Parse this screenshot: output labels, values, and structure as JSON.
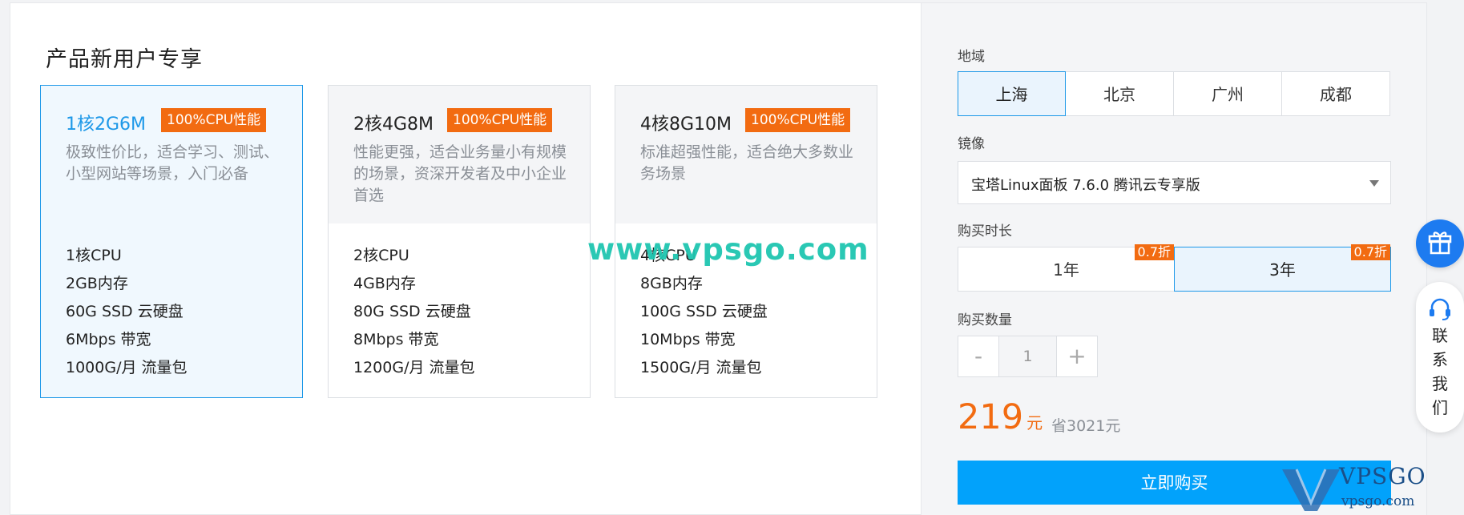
{
  "main": {
    "title": "产品新用户专享",
    "watermark": "www.vpsgo.com",
    "plans": [
      {
        "name": "1核2G6M",
        "badge": "100%CPU性能",
        "desc": "极致性价比，适合学习、测试、小型网站等场景，入门必备",
        "selected": true,
        "specs": [
          "1核CPU",
          "2GB内存",
          "60G SSD 云硬盘",
          "6Mbps 带宽",
          "1000G/月 流量包"
        ]
      },
      {
        "name": "2核4G8M",
        "badge": "100%CPU性能",
        "desc": "性能更强，适合业务量小有规模的场景，资深开发者及中小企业首选",
        "selected": false,
        "specs": [
          "2核CPU",
          "4GB内存",
          "80G SSD 云硬盘",
          "8Mbps 带宽",
          "1200G/月 流量包"
        ]
      },
      {
        "name": "4核8G10M",
        "badge": "100%CPU性能",
        "desc": "标准超强性能，适合绝大多数业务场景",
        "selected": false,
        "specs": [
          "4核CPU",
          "8GB内存",
          "100G SSD 云硬盘",
          "10Mbps 带宽",
          "1500G/月 流量包"
        ]
      }
    ]
  },
  "sidebar": {
    "region_label": "地域",
    "regions": [
      "上海",
      "北京",
      "广州",
      "成都"
    ],
    "region_selected": "上海",
    "image_label": "镜像",
    "image_value": "宝塔Linux面板 7.6.0 腾讯云专享版",
    "duration_label": "购买时长",
    "durations": [
      {
        "label": "1年",
        "discount": "0.7折",
        "active": false
      },
      {
        "label": "3年",
        "discount": "0.7折",
        "active": true
      }
    ],
    "quantity_label": "购买数量",
    "quantity": {
      "minus": "-",
      "value": "1",
      "plus": "+"
    },
    "price": "219",
    "price_unit": "元",
    "savings": "省3021元",
    "buy_label": "立即购买"
  },
  "float": {
    "contact": "联系我们"
  },
  "logo": {
    "top": "VPSGO",
    "bottom": "vpsgo.com"
  },
  "colors": {
    "accent": "#1d98e8",
    "buy_button": "#02a2fb",
    "badge": "#f26b11",
    "price": "#f26b11"
  },
  "icons": [
    "gift-icon",
    "headset-icon",
    "select-caret-icon"
  ]
}
